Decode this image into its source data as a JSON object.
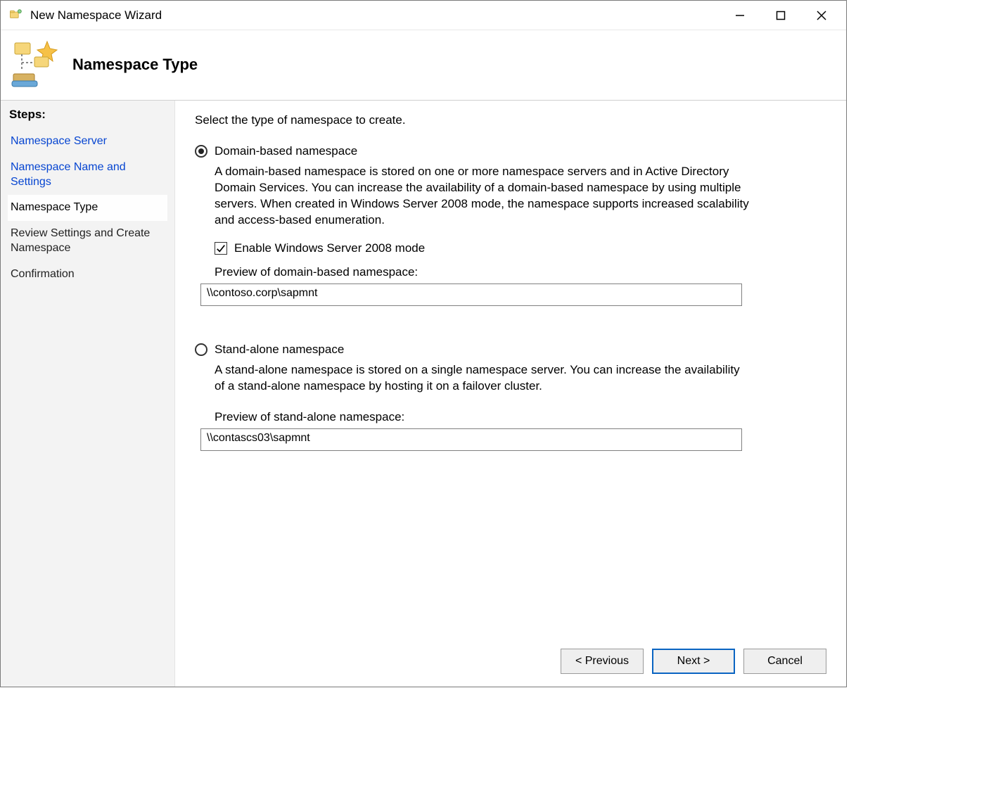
{
  "window": {
    "title": "New Namespace Wizard"
  },
  "header": {
    "heading": "Namespace Type"
  },
  "sidebar": {
    "steps_label": "Steps:",
    "items": [
      {
        "label": "Namespace Server",
        "state": "link"
      },
      {
        "label": "Namespace Name and Settings",
        "state": "link"
      },
      {
        "label": "Namespace Type",
        "state": "current"
      },
      {
        "label": "Review Settings and Create Namespace",
        "state": "future"
      },
      {
        "label": "Confirmation",
        "state": "future"
      }
    ]
  },
  "main": {
    "prompt": "Select the type of namespace to create.",
    "domain_option": {
      "label": "Domain-based namespace",
      "selected": true,
      "description": "A domain-based namespace is stored on one or more namespace servers and in Active Directory Domain Services. You can increase the availability of a domain-based namespace by using multiple servers. When created in Windows Server 2008 mode, the namespace supports increased scalability and access-based enumeration.",
      "checkbox_label": "Enable Windows Server 2008 mode",
      "checkbox_checked": true,
      "preview_label": "Preview of domain-based namespace:",
      "preview_value": "\\\\contoso.corp\\sapmnt"
    },
    "standalone_option": {
      "label": "Stand-alone namespace",
      "selected": false,
      "description": "A stand-alone namespace is stored on a single namespace server. You can increase the availability of a stand-alone namespace by hosting it on a failover cluster.",
      "preview_label": "Preview of stand-alone namespace:",
      "preview_value": "\\\\contascs03\\sapmnt"
    }
  },
  "footer": {
    "previous": "< Previous",
    "next": "Next >",
    "cancel": "Cancel"
  }
}
